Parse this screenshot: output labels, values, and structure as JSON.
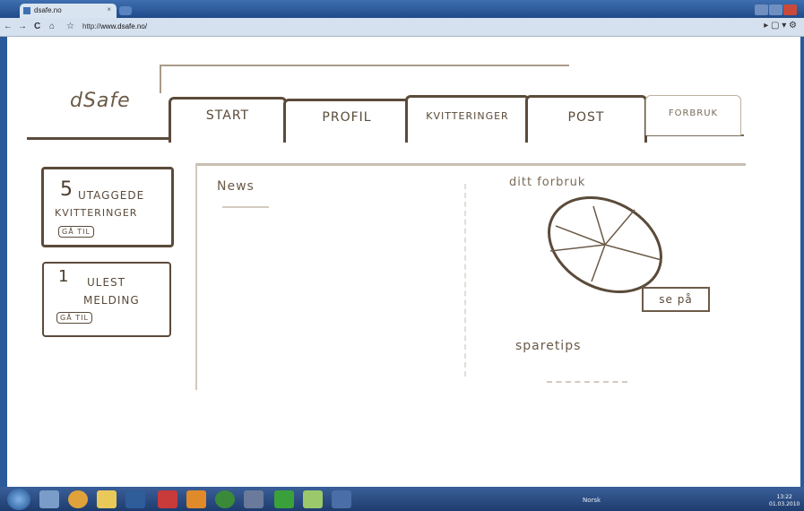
{
  "browser": {
    "tab_title": "dsafe.no",
    "url_prefix": "http://",
    "url_host": "www.dsafe.no/",
    "nav": {
      "back": "←",
      "forward": "→",
      "reload": "C",
      "home": "⌂",
      "star": "☆"
    },
    "tools": "▸ ▢ ▾ ⚙"
  },
  "app": {
    "logo": "dSafe",
    "tabs": [
      "START",
      "PROFIL",
      "KVITTERINGER",
      "POST",
      "FORBRUK"
    ]
  },
  "widgets": [
    {
      "count": "5",
      "line1": "UTAGGEDE",
      "line2": "KVITTERINGER",
      "action": "GÅ TIL"
    },
    {
      "count": "1",
      "line1": "ULEST",
      "line2": "MELDING",
      "action": "GÅ TIL"
    }
  ],
  "main": {
    "news_heading": "News",
    "forbruk_heading": "ditt forbruk",
    "se_pa_button": "se på",
    "sparetips_heading": "sparetips"
  },
  "taskbar": {
    "tray_text": "Norsk",
    "clock_time": "13:22",
    "clock_date": "01.03.2010"
  }
}
